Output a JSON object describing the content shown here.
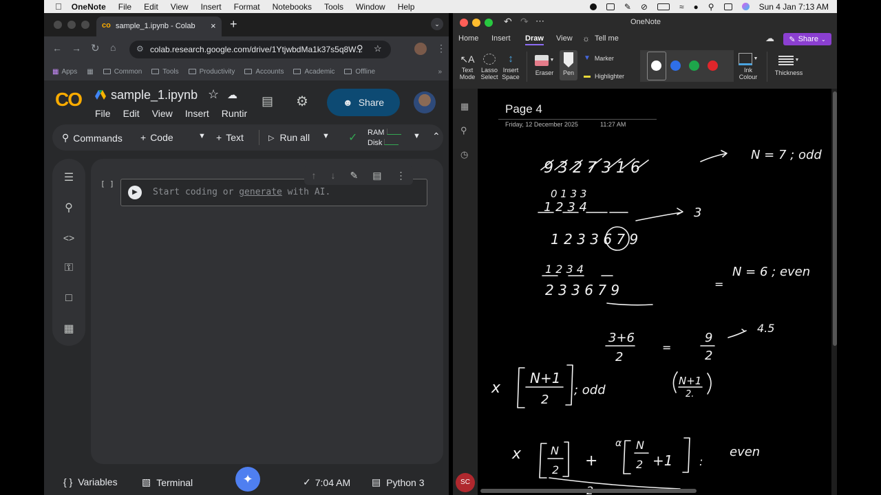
{
  "menubar": {
    "app_name": "OneNote",
    "items": [
      "File",
      "Edit",
      "View",
      "Insert",
      "Format",
      "Notebooks",
      "Tools",
      "Window",
      "Help"
    ],
    "datetime": "Sun 4 Jan  7:13 AM"
  },
  "browser": {
    "tab_title": "sample_1.ipynb - Colab",
    "url": "colab.research.google.com/drive/1YtjwbdMa1k37s5q8W...",
    "bookmarks": [
      "Apps",
      "Common",
      "Tools",
      "Productivity",
      "Accounts",
      "Academic",
      "Offline"
    ]
  },
  "colab": {
    "logo": "CO",
    "notebook_name": "sample_1.ipynb",
    "menu": [
      "File",
      "Edit",
      "View",
      "Insert",
      "Runtir"
    ],
    "share_label": "Share",
    "toolbar": {
      "commands": "Commands",
      "code": "Code",
      "text": "Text",
      "run_all": "Run all",
      "ram": "RAM",
      "disk": "Disk"
    },
    "cell": {
      "brackets": "[ ]",
      "placeholder_start": "Start coding or ",
      "placeholder_link": "generate",
      "placeholder_end": " with AI."
    },
    "statusbar": {
      "variables": "Variables",
      "terminal": "Terminal",
      "time": "7:04 AM",
      "runtime": "Python 3"
    }
  },
  "onenote": {
    "window_title": "OneNote",
    "tabs": [
      "Home",
      "Insert",
      "Draw",
      "View"
    ],
    "active_tab": "Draw",
    "tell_me": "Tell me",
    "share_label": "Share",
    "ribbon": {
      "text_mode": [
        "Text",
        "Mode"
      ],
      "lasso_select": [
        "Lasso",
        "Select"
      ],
      "insert_space": [
        "Insert",
        "Space"
      ],
      "eraser": "Eraser",
      "pen": "Pen",
      "marker": "Marker",
      "highlighter": "Highlighter",
      "ink_colour": [
        "Ink",
        "Colour"
      ],
      "thickness": "Thickness"
    },
    "pen_colors": [
      "#ffffff",
      "#2f6fe8",
      "#1ea64b",
      "#e0262b"
    ],
    "page": {
      "title": "Page 4",
      "date": "Friday, 12 December 2025",
      "time": "11:27 AM"
    },
    "user_initials": "SC",
    "ink_texts": {
      "n_odd": "N = 7 ; odd",
      "n_even": "N = 6 ; even",
      "result": "4.5",
      "odd": "odd",
      "even": "even"
    }
  }
}
